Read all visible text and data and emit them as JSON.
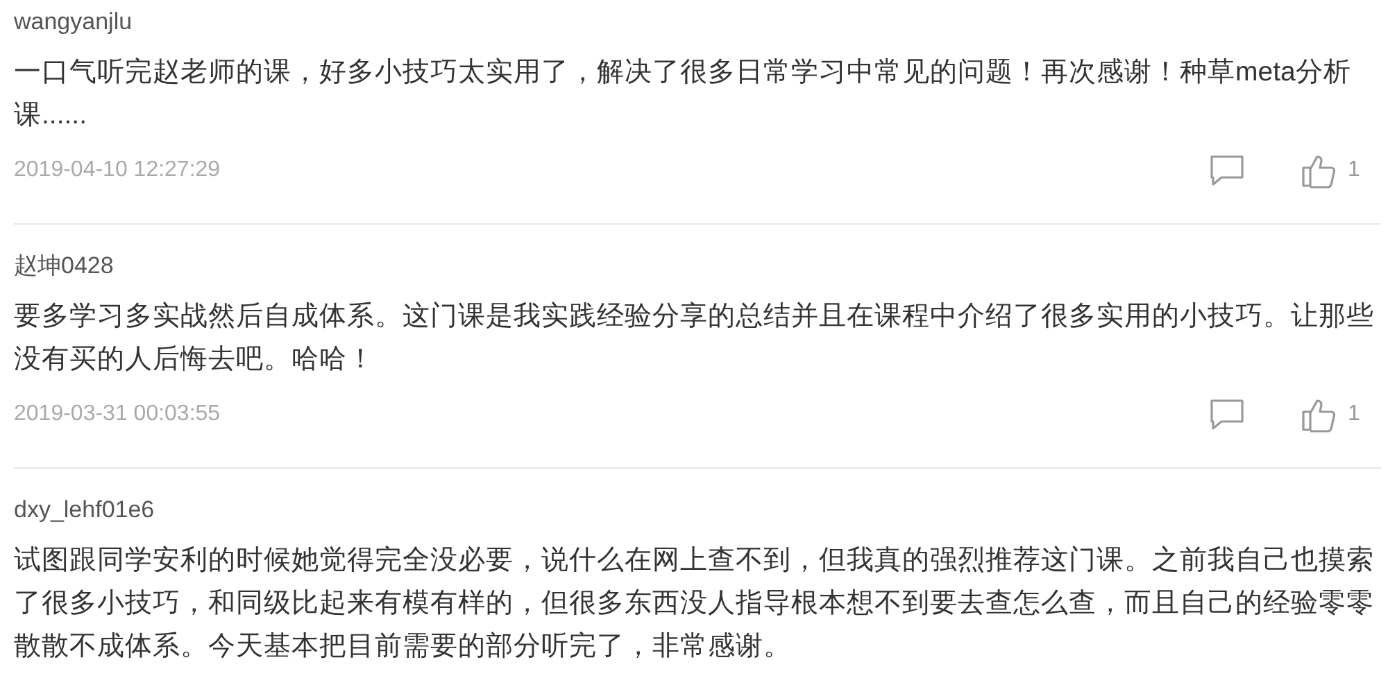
{
  "comments": [
    {
      "username": "wangyanjlu",
      "text": "一口气听完赵老师的课，好多小技巧太实用了，解决了很多日常学习中常见的问题！再次感谢！种草meta分析课......",
      "time": "2019-04-10 12:27:29",
      "likes": "1"
    },
    {
      "username": "赵坤0428",
      "text": "要多学习多实战然后自成体系。这门课是我实践经验分享的总结并且在课程中介绍了很多实用的小技巧。让那些没有买的人后悔去吧。哈哈！",
      "time": "2019-03-31 00:03:55",
      "likes": "1"
    },
    {
      "username": "dxy_lehf01e6",
      "text": "试图跟同学安利的时候她觉得完全没必要，说什么在网上查不到，但我真的强烈推荐这门课。之前我自己也摸索了很多小技巧，和同级比起来有模有样的，但很多东西没人指导根本想不到要去查怎么查，而且自己的经验零零散散不成体系。今天基本把目前需要的部分听完了，非常感谢。"
    }
  ]
}
